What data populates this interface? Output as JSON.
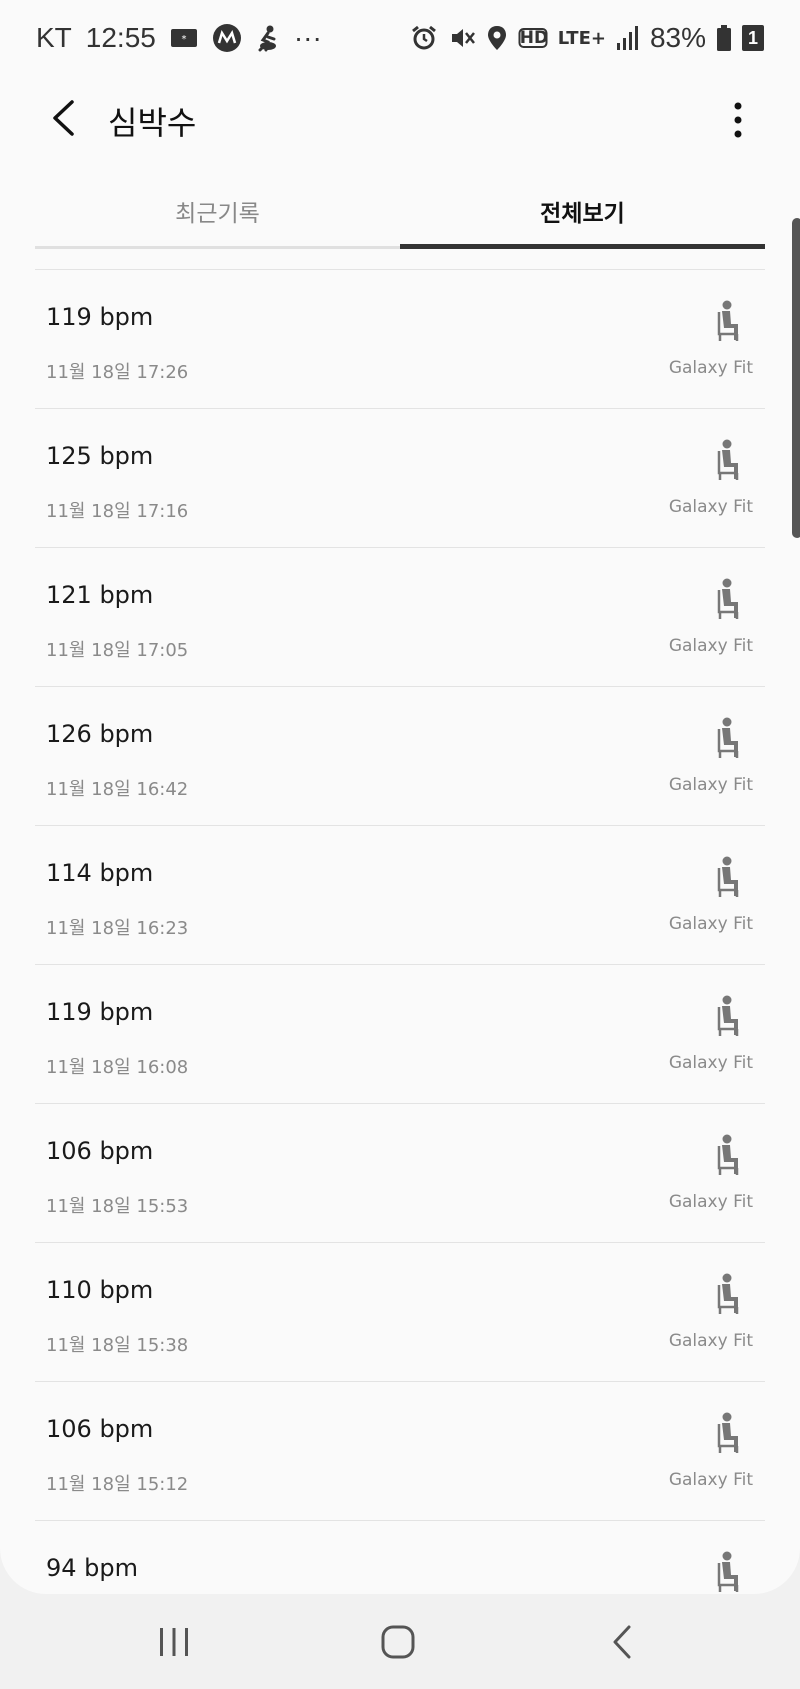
{
  "status_bar": {
    "carrier": "KT",
    "time": "12:55",
    "network": "LTE+",
    "hd_label": "HD",
    "battery": "83%",
    "sim": "1",
    "overflow": "···"
  },
  "header": {
    "title": "심박수"
  },
  "tabs": [
    {
      "label": "최근기록",
      "active": false
    },
    {
      "label": "전체보기",
      "active": true
    }
  ],
  "records": [
    {
      "bpm": "119 bpm",
      "time": "11월 18일 17:26",
      "device": "Galaxy Fit",
      "icon": "sitting-person-icon"
    },
    {
      "bpm": "125 bpm",
      "time": "11월 18일 17:16",
      "device": "Galaxy Fit",
      "icon": "sitting-person-icon"
    },
    {
      "bpm": "121 bpm",
      "time": "11월 18일 17:05",
      "device": "Galaxy Fit",
      "icon": "sitting-person-icon"
    },
    {
      "bpm": "126 bpm",
      "time": "11월 18일 16:42",
      "device": "Galaxy Fit",
      "icon": "sitting-person-icon"
    },
    {
      "bpm": "114 bpm",
      "time": "11월 18일 16:23",
      "device": "Galaxy Fit",
      "icon": "sitting-person-icon"
    },
    {
      "bpm": "119 bpm",
      "time": "11월 18일 16:08",
      "device": "Galaxy Fit",
      "icon": "sitting-person-icon"
    },
    {
      "bpm": "106 bpm",
      "time": "11월 18일 15:53",
      "device": "Galaxy Fit",
      "icon": "sitting-person-icon"
    },
    {
      "bpm": "110 bpm",
      "time": "11월 18일 15:38",
      "device": "Galaxy Fit",
      "icon": "sitting-person-icon"
    },
    {
      "bpm": "106 bpm",
      "time": "11월 18일 15:12",
      "device": "Galaxy Fit",
      "icon": "sitting-person-icon"
    },
    {
      "bpm": "94 bpm",
      "time": "",
      "device": "",
      "icon": "sitting-person-icon"
    }
  ],
  "colors": {
    "background": "#fafafa",
    "text_primary": "#1a1a1a",
    "text_secondary": "#8a8a8a",
    "tab_indicator": "#333333",
    "divider": "#e3e3e3"
  }
}
